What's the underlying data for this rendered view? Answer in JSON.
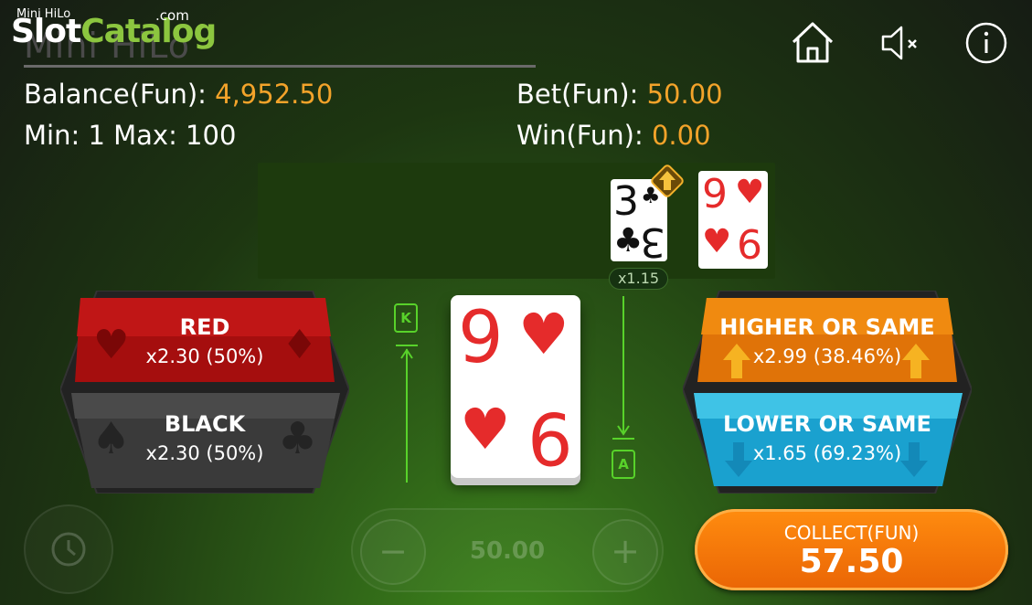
{
  "watermark": {
    "small": "Mini HiLo",
    "slot": "Slot",
    "catalog": "Catalog",
    "com": ".com"
  },
  "game_title": "Mini HiLo",
  "info": {
    "balance_label": "Balance(Fun): ",
    "balance_value": "4,952.50",
    "bet_label": "Bet(Fun): ",
    "bet_value": "50.00",
    "limits_label": "Min: 1 Max: 100",
    "win_label": "Win(Fun): ",
    "win_value": "0.00"
  },
  "history": {
    "cards": [
      {
        "rank": "3",
        "suit": "♣",
        "color": "#111111"
      },
      {
        "rank": "9",
        "suit": "♥",
        "color": "#e52b2b"
      }
    ],
    "direction_icon": "up-arrow-icon",
    "multiplier": "x1.15"
  },
  "bets": {
    "red": {
      "label": "RED",
      "sub": "x2.30 (50%)"
    },
    "black": {
      "label": "BLACK",
      "sub": "x2.30 (50%)"
    },
    "higher": {
      "label": "HIGHER OR SAME",
      "sub": "x2.99 (38.46%)"
    },
    "lower": {
      "label": "LOWER OR SAME",
      "sub": "x1.65 (69.23%)"
    }
  },
  "current_card": {
    "rank": "9",
    "suit": "♥"
  },
  "range": {
    "top": "K",
    "bottom": "A"
  },
  "stake": {
    "value": "50.00",
    "minus": "−",
    "plus": "+"
  },
  "collect": {
    "label": "COLLECT(FUN)",
    "amount": "57.50"
  },
  "colors": {
    "accent": "#f3a32a",
    "green": "#58d22a",
    "red_button": "#b01010",
    "orange_button": "#ea7a0f",
    "blue_button": "#1fa9d4"
  }
}
